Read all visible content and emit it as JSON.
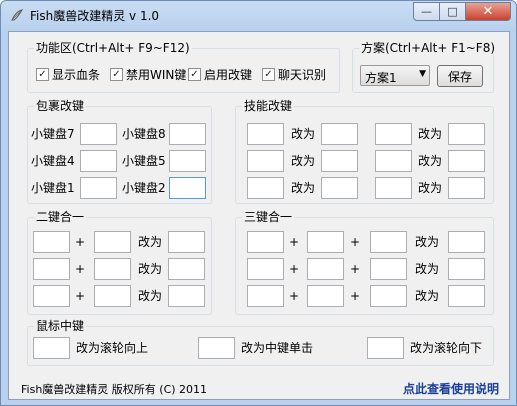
{
  "window": {
    "title": "Fish魔兽改建精灵 v 1.0",
    "controls": {
      "minimize": "—",
      "maximize": "□",
      "close": "✕"
    }
  },
  "function_area": {
    "title": "功能区(Ctrl+Alt+ F9~F12)",
    "checkboxes": [
      {
        "label": "显示血条",
        "checked": true
      },
      {
        "label": "禁用WIN键",
        "checked": true
      },
      {
        "label": "启用改键",
        "checked": true
      },
      {
        "label": "聊天识别",
        "checked": true
      }
    ]
  },
  "scheme": {
    "title": "方案(Ctrl+Alt+ F1~F8)",
    "selected": "方案1",
    "save_label": "保存"
  },
  "inventory": {
    "title": "包裹改键",
    "slots": [
      "小键盘7",
      "小键盘8",
      "小键盘4",
      "小键盘5",
      "小键盘1",
      "小键盘2"
    ]
  },
  "skills": {
    "title": "技能改键",
    "change_to": "改为"
  },
  "combo2": {
    "title": "二键合一",
    "plus": "+",
    "change_to": "改为"
  },
  "combo3": {
    "title": "三键合一",
    "plus": "+",
    "change_to": "改为"
  },
  "mouse": {
    "title": "鼠标中键",
    "scroll_up": "改为滚轮向上",
    "middle_click": "改为中键单击",
    "scroll_down": "改为滚轮向下"
  },
  "footer": {
    "copyright": "Fish魔兽改建精灵  版权所有 (C) 2011",
    "help_link": "点此查看使用说明"
  }
}
